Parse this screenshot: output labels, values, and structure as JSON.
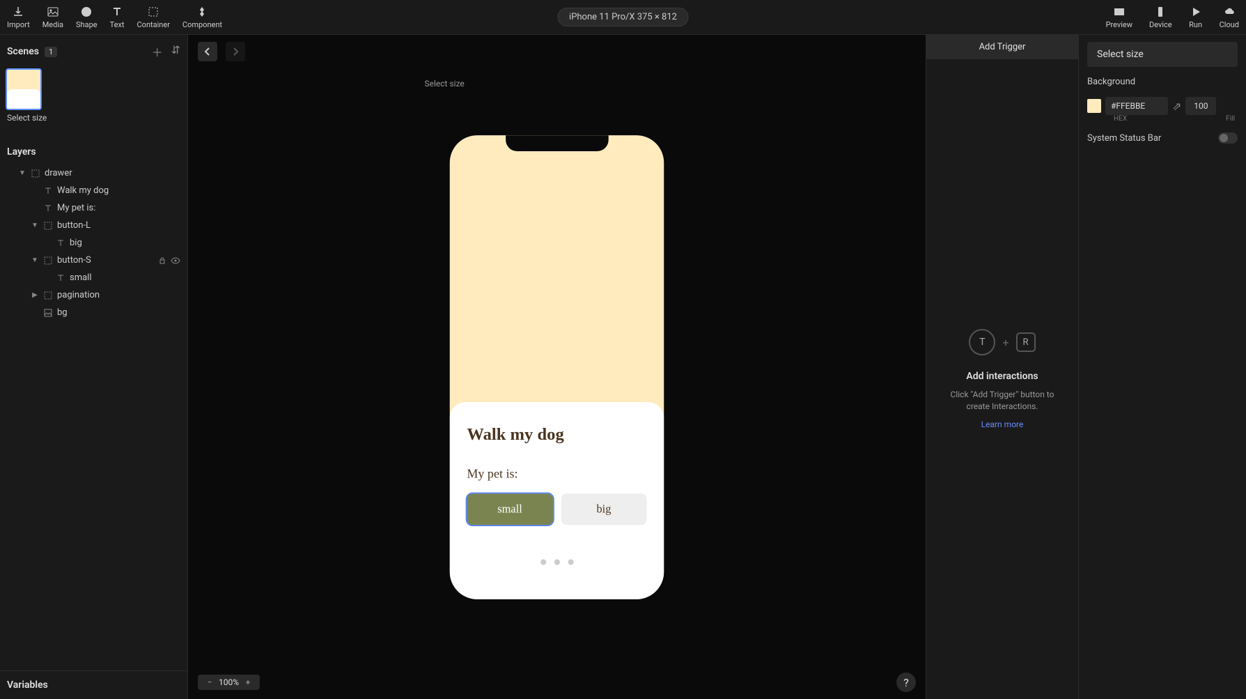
{
  "toolbar": {
    "import": "Import",
    "media": "Media",
    "shape": "Shape",
    "text": "Text",
    "container": "Container",
    "component": "Component",
    "device_label": "iPhone 11 Pro/X  375 × 812",
    "preview": "Preview",
    "device": "Device",
    "run": "Run",
    "cloud": "Cloud"
  },
  "scenes": {
    "title": "Scenes",
    "count": "1",
    "thumb_label": "Select size"
  },
  "layers": {
    "title": "Layers",
    "items": [
      {
        "name": "drawer",
        "indent": 1,
        "caret": "▼",
        "icon": "container"
      },
      {
        "name": "Walk my dog",
        "indent": 2,
        "caret": "",
        "icon": "text"
      },
      {
        "name": "My pet is:",
        "indent": 2,
        "caret": "",
        "icon": "text"
      },
      {
        "name": "button-L",
        "indent": 2,
        "caret": "▼",
        "icon": "container"
      },
      {
        "name": "big",
        "indent": 3,
        "caret": "",
        "icon": "text"
      },
      {
        "name": "button-S",
        "indent": 2,
        "caret": "▼",
        "icon": "container",
        "hovering": true
      },
      {
        "name": "small",
        "indent": 3,
        "caret": "",
        "icon": "text"
      },
      {
        "name": "pagination",
        "indent": 2,
        "caret": "▶",
        "icon": "container"
      },
      {
        "name": "bg",
        "indent": 2,
        "caret": "",
        "icon": "image"
      }
    ]
  },
  "variables": {
    "title": "Variables"
  },
  "canvas": {
    "scene_label": "Select size",
    "zoom": "100%",
    "drawer_title": "Walk my dog",
    "drawer_sub": "My pet is:",
    "btn_small": "small",
    "btn_big": "big"
  },
  "interactions": {
    "add_trigger": "Add Trigger",
    "t_letter": "T",
    "r_letter": "R",
    "plus": "+",
    "title": "Add interactions",
    "desc": "Click \"Add Trigger\" button to create Interactions.",
    "learn_more": "Learn more"
  },
  "props": {
    "select_size": "Select size",
    "background": "Background",
    "hex": "#FFEBBE",
    "hex_label": "HEX",
    "fill": "100",
    "fill_label": "Fill",
    "status_bar": "System Status Bar"
  }
}
